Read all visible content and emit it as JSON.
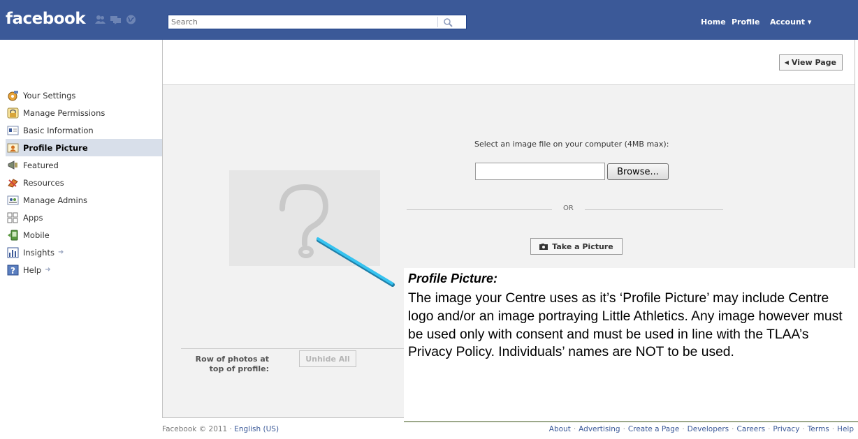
{
  "topbar": {
    "logo": "facebook",
    "search_placeholder": "Search",
    "nav": {
      "home": "Home",
      "profile": "Profile",
      "account": "Account ▾"
    }
  },
  "sidebar": {
    "items": [
      {
        "label": "Your Settings",
        "icon": "settings-icon"
      },
      {
        "label": "Manage Permissions",
        "icon": "lock-icon"
      },
      {
        "label": "Basic Information",
        "icon": "info-card-icon"
      },
      {
        "label": "Profile Picture",
        "icon": "profile-picture-icon",
        "active": true
      },
      {
        "label": "Featured",
        "icon": "megaphone-icon"
      },
      {
        "label": "Resources",
        "icon": "resources-icon"
      },
      {
        "label": "Manage Admins",
        "icon": "admins-icon"
      },
      {
        "label": "Apps",
        "icon": "apps-icon"
      },
      {
        "label": "Mobile",
        "icon": "mobile-icon"
      },
      {
        "label": "Insights",
        "icon": "insights-icon"
      },
      {
        "label": "Help",
        "icon": "help-icon"
      }
    ]
  },
  "main": {
    "view_page": "View Page",
    "select_text": "Select an image file on your computer (4MB max):",
    "browse": "Browse...",
    "or": "OR",
    "take_picture": "Take a Picture",
    "row_label": "Row of photos at top of profile:",
    "unhide_all": "Unhide All",
    "placeholder_glyph": "?"
  },
  "footer": {
    "copyright": "Facebook © 2011 · ",
    "language": "English (US)",
    "links": [
      "About",
      "Advertising",
      "Create a Page",
      "Developers",
      "Careers",
      "Privacy",
      "Terms",
      "Help"
    ]
  },
  "callout": {
    "title": "Profile Picture:",
    "body": "The image your Centre uses as it’s ‘Profile Picture’ may include Centre logo and/or an image portraying Little Athletics.  Any image however must be used only with consent and must be used in line with the TLAA’s Privacy Policy.  Individuals’ names are NOT to be used."
  },
  "colors": {
    "brand": "#3b5998",
    "sidebar_active": "#d8dfea",
    "pointer": "#29b6e8"
  }
}
